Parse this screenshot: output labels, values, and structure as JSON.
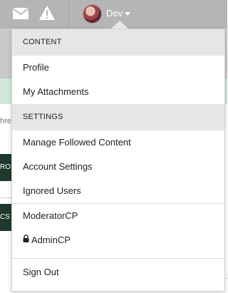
{
  "header": {
    "messages_icon": "envelope-icon",
    "alerts_icon": "warning-icon",
    "username": "Dev"
  },
  "background": {
    "snippet_text": "hrea",
    "dark_button_1": "RO F",
    "dark_button_2": "CS"
  },
  "menu": {
    "sections": [
      {
        "header": "CONTENT",
        "items": [
          "Profile",
          "My Attachments"
        ]
      },
      {
        "header": "SETTINGS",
        "items": [
          "Manage Followed Content",
          "Account Settings",
          "Ignored Users"
        ]
      }
    ],
    "admin_items": [
      "ModeratorCP",
      "AdminCP"
    ],
    "signout": "Sign Out"
  },
  "colors": {
    "topbar": "#b5b5b5",
    "section_header_bg": "#e6e6e6",
    "text": "#222222"
  }
}
